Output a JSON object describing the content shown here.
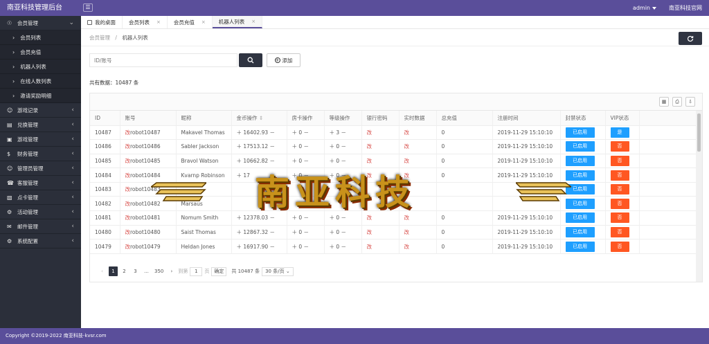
{
  "header": {
    "title": "南亚科技管理后台",
    "menu_toggle": "☰",
    "user": "admin",
    "site_link": "南亚科技官网"
  },
  "sidebar": {
    "groups": [
      {
        "label": "会员管理",
        "expanded": true,
        "children": [
          "会员列表",
          "会员充值",
          "机器人列表",
          "在线人数列表",
          "邀请奖励明细"
        ]
      },
      {
        "label": "游戏记录"
      },
      {
        "label": "兑换管理"
      },
      {
        "label": "游戏管理"
      },
      {
        "label": "财务管理"
      },
      {
        "label": "管理员管理"
      },
      {
        "label": "客服管理"
      },
      {
        "label": "点卡管理"
      },
      {
        "label": "活动管理"
      },
      {
        "label": "邮件管理"
      },
      {
        "label": "系统配置"
      }
    ]
  },
  "tabs": [
    {
      "label": "我的桌面"
    },
    {
      "label": "会员列表",
      "close": "×"
    },
    {
      "label": "会员充值",
      "close": "×"
    },
    {
      "label": "机器人列表",
      "close": "×",
      "active": true
    }
  ],
  "breadcrumb": {
    "parent": "会员管理",
    "sep": "/",
    "current": "机器人列表"
  },
  "search": {
    "placeholder": "ID/账号"
  },
  "add_label": "添加",
  "total_text": "共有数据：10487 条",
  "table": {
    "headers": [
      "ID",
      "账号",
      "昵称",
      "金币操作",
      "房卡操作",
      "等级操作",
      "银行密码",
      "实时数据",
      "总充值",
      "注册时间",
      "封禁状态",
      "VIP状态"
    ],
    "sort_icon": "⇕",
    "rows": [
      {
        "id": "10487",
        "tag": "改",
        "account": "robot10487",
        "nick": "Makavel Thomas",
        "gold": "＋ 16402.93 －",
        "card": "＋ 0 －",
        "level": "＋ 3 －",
        "bank": "改",
        "realtime": "改",
        "recharge": "0",
        "time": "2019-11-29 15:10:10",
        "ban": "已启用",
        "vip": "是",
        "vip_color": "blue"
      },
      {
        "id": "10486",
        "tag": "改",
        "account": "robot10486",
        "nick": "Sabler Jackson",
        "gold": "＋ 17513.12 －",
        "card": "＋ 0 －",
        "level": "＋ 0 －",
        "bank": "改",
        "realtime": "改",
        "recharge": "0",
        "time": "2019-11-29 15:10:10",
        "ban": "已启用",
        "vip": "否",
        "vip_color": "orange"
      },
      {
        "id": "10485",
        "tag": "改",
        "account": "robot10485",
        "nick": "Bravol Watson",
        "gold": "＋ 10662.82 －",
        "card": "＋ 0 －",
        "level": "＋ 0 －",
        "bank": "改",
        "realtime": "改",
        "recharge": "0",
        "time": "2019-11-29 15:10:10",
        "ban": "已启用",
        "vip": "否",
        "vip_color": "orange"
      },
      {
        "id": "10484",
        "tag": "改",
        "account": "robot10484",
        "nick": "Kvarnp Robinson",
        "gold": "＋ 17",
        "card": "＋ 0 －",
        "level": "＋ 0 －",
        "bank": "改",
        "realtime": "改",
        "recharge": "0",
        "time": "2019-11-29 15:10:10",
        "ban": "已启用",
        "vip": "否",
        "vip_color": "orange"
      },
      {
        "id": "10483",
        "tag": "改",
        "account": "robot10483",
        "nick": "",
        "gold": "",
        "card": "",
        "level": "",
        "bank": "",
        "realtime": "",
        "recharge": "",
        "time": "",
        "ban": "已启用",
        "vip": "否",
        "vip_color": "orange"
      },
      {
        "id": "10482",
        "tag": "改",
        "account": "robot10482",
        "nick": "Marsaus",
        "gold": "",
        "card": "",
        "level": "",
        "bank": "",
        "realtime": "",
        "recharge": "",
        "time": "",
        "ban": "已启用",
        "vip": "否",
        "vip_color": "orange"
      },
      {
        "id": "10481",
        "tag": "改",
        "account": "robot10481",
        "nick": "Nomum Smith",
        "gold": "＋ 12378.03 －",
        "card": "＋ 0 －",
        "level": "＋ 0 －",
        "bank": "改",
        "realtime": "改",
        "recharge": "0",
        "time": "2019-11-29 15:10:10",
        "ban": "已启用",
        "vip": "否",
        "vip_color": "orange"
      },
      {
        "id": "10480",
        "tag": "改",
        "account": "robot10480",
        "nick": "Saist Thomas",
        "gold": "＋ 12867.32 －",
        "card": "＋ 0 －",
        "level": "＋ 0 －",
        "bank": "改",
        "realtime": "改",
        "recharge": "0",
        "time": "2019-11-29 15:10:10",
        "ban": "已启用",
        "vip": "否",
        "vip_color": "orange"
      },
      {
        "id": "10479",
        "tag": "改",
        "account": "robot10479",
        "nick": "Heldan Jones",
        "gold": "＋ 16917.90 －",
        "card": "＋ 0 －",
        "level": "＋ 0 －",
        "bank": "改",
        "realtime": "改",
        "recharge": "0",
        "time": "2019-11-29 15:10:10",
        "ban": "已启用",
        "vip": "否",
        "vip_color": "orange"
      }
    ]
  },
  "pager": {
    "prev": "‹",
    "next": "›",
    "pages": [
      "1",
      "2",
      "3",
      "...",
      "350"
    ],
    "goto_label": "到第",
    "goto_value": "1",
    "unit": "页",
    "ok": "确定",
    "total": "共 10487 条",
    "size": "30 条/页"
  },
  "watermark": "南亚科技",
  "footer": "Copyright ©2019-2022 南亚科技-kvsr.com",
  "colors": {
    "primary": "#5a4e9a",
    "sidebar": "#2b2f3a",
    "blue": "#1e9fff",
    "orange": "#ff5722"
  }
}
